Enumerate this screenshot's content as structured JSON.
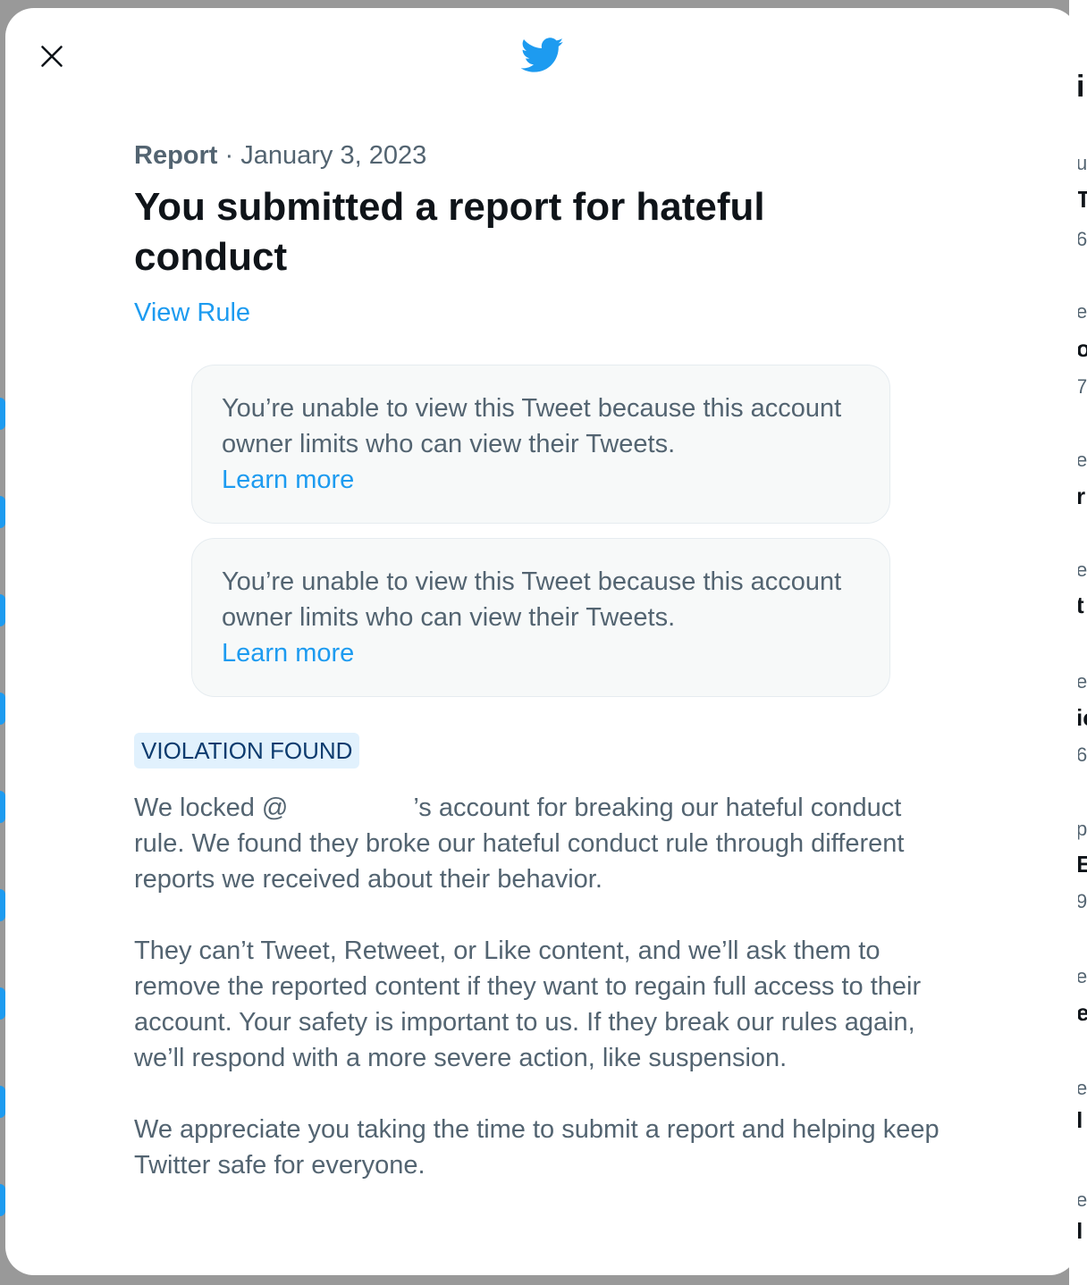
{
  "modal": {
    "close_label": "Close",
    "report_label": "Report",
    "separator": " · ",
    "date": "January 3, 2023",
    "title": "You submitted a report for hateful conduct",
    "view_rule": "View Rule",
    "tweets": [
      {
        "message": "You’re unable to view this Tweet because this account owner limits who can view their Tweets.",
        "learn_more": "Learn more"
      },
      {
        "message": "You’re unable to view this Tweet because this account owner limits who can view their Tweets.",
        "learn_more": "Learn more"
      }
    ],
    "badge": "VIOLATION FOUND",
    "paragraph1_prefix": "We locked @",
    "paragraph1_suffix": "’s account for breaking our hateful conduct rule. We found they broke our hateful conduct rule through different reports we received about their behavior.",
    "paragraph2": "They can’t Tweet, Retweet, or Like content, and we’ll ask them to remove the reported content if they want to regain full access to their account. Your safety is important to us. If they break our rules again, we’ll respond with a more severe action, like suspension.",
    "paragraph3": "We appreciate you taking the time to submit a report and helping keep Twitter safe for everyone."
  },
  "backdrop": {
    "right_marks": [
      "i",
      "u",
      "T",
      "6",
      "e",
      "o",
      "7",
      "e",
      "r",
      "e",
      "t",
      "e",
      "ic",
      "6",
      "p",
      "E",
      "9",
      "e",
      "e",
      "e",
      "I",
      "e",
      "I"
    ]
  },
  "colors": {
    "accent": "#1d9bf0",
    "text_primary": "#0f1419",
    "text_secondary": "#536471",
    "badge_bg": "#e1f1fd",
    "badge_text": "#0c3b6e",
    "card_bg": "#f7f9f9"
  },
  "icons": {
    "close": "close-icon",
    "logo": "twitter-bird-icon"
  }
}
